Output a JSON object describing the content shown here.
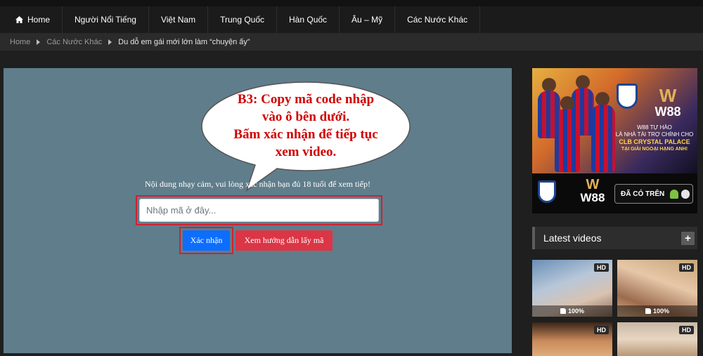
{
  "nav": {
    "home_label": "Home",
    "items": [
      "Người Nổi Tiếng",
      "Việt Nam",
      "Trung Quốc",
      "Hàn Quốc",
      "Âu – Mỹ",
      "Các Nước Khác"
    ]
  },
  "breadcrumb": {
    "home": "Home",
    "category": "Các Nước Khác",
    "current": "Du dỗ em gái mới lớn làm “chuyện ấy”"
  },
  "instruction_bubble": {
    "line1": "B3: Copy mã code nhập",
    "line2": "vào ô bên dưới.",
    "line3": "Bấm xác nhận để tiếp tục",
    "line4": "xem video."
  },
  "gate": {
    "notice": "Nội dung nhạy cảm, vui lòng xác nhận bạn đủ 18 tuổi để xem tiếp!",
    "input_placeholder": "Nhập mã ở đây...",
    "input_value": "",
    "confirm_label": "Xác nhận",
    "guide_label": "Xem hướng dẫn lấy mã",
    "highlight_color": "#d32030",
    "confirm_color": "#0d6efd",
    "guide_color": "#dc3545"
  },
  "ad": {
    "brand": "W88",
    "line1": "W88 TỰ HÀO",
    "line2": "LÀ NHÀ TÀI TRỢ CHÍNH CHO",
    "line3": "CLB CRYSTAL PALACE",
    "line4": "TẠI GIẢI NGOẠI HẠNG ANH!",
    "store_label": "ĐÃ CÓ TRÊN",
    "jersey_sponsor": "W88"
  },
  "latest_videos": {
    "title": "Latest videos",
    "more_icon": "+",
    "items": [
      {
        "badge": "HD",
        "rating": "100%"
      },
      {
        "badge": "HD",
        "rating": "100%"
      },
      {
        "badge": "HD"
      },
      {
        "badge": "HD"
      }
    ]
  }
}
